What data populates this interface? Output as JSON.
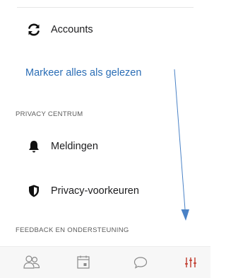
{
  "menu": {
    "accounts_label": "Accounts",
    "mark_all_read_label": "Markeer alles als gelezen",
    "privacy_section_header": "PRIVACY CENTRUM",
    "notifications_label": "Meldingen",
    "privacy_preferences_label": "Privacy-voorkeuren",
    "feedback_section_header": "FEEDBACK EN ONDERSTEUNING"
  },
  "icons": {
    "accounts": "sync-icon",
    "notifications": "bell-icon",
    "privacy": "shield-icon"
  },
  "tabbar": {
    "tabs": [
      {
        "icon": "people-icon",
        "active": false
      },
      {
        "icon": "calendar-icon",
        "active": false
      },
      {
        "icon": "chat-icon",
        "active": false
      },
      {
        "icon": "settings-sliders-icon",
        "active": true
      }
    ]
  },
  "colors": {
    "link": "#2a6db5",
    "active_tab": "#c0392b",
    "annotation_arrow": "#4a82c6"
  }
}
